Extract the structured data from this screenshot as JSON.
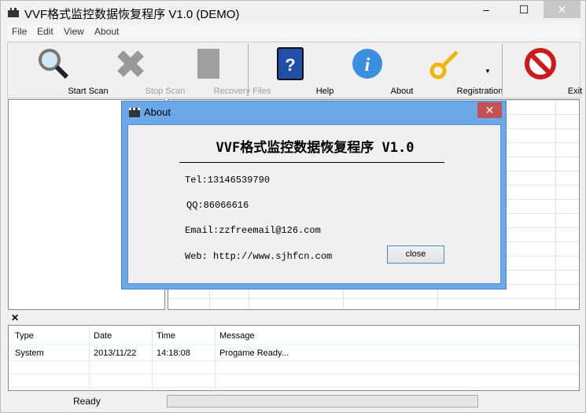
{
  "window": {
    "title": "VVF格式监控数据恢复程序 V1.0 (DEMO)",
    "minimize": "‒",
    "maximize": "☐",
    "close": "✕"
  },
  "menu": [
    "File",
    "Edit",
    "View",
    "About"
  ],
  "toolbar": [
    {
      "label": "Start Scan",
      "icon": "magnifier-icon",
      "enabled": true
    },
    {
      "label": "Stop Scan",
      "icon": "x-icon",
      "enabled": false
    },
    {
      "label": "Recovery  Files",
      "icon": "files-icon",
      "enabled": false
    },
    {
      "label": "Help",
      "icon": "help-book-icon",
      "enabled": true
    },
    {
      "label": "About",
      "icon": "info-icon",
      "enabled": true
    },
    {
      "label": "Registration",
      "icon": "key-icon",
      "enabled": true
    },
    {
      "label": "Exit",
      "icon": "no-entry-icon",
      "enabled": true
    }
  ],
  "log": {
    "close": "✕",
    "headers": [
      "Type",
      "Date",
      "Time",
      "Message"
    ],
    "rows": [
      [
        "System",
        "2013/11/22",
        "14:18:08",
        "Progame Ready..."
      ]
    ]
  },
  "status": {
    "text": "Ready"
  },
  "about_dialog": {
    "title": "About",
    "heading": "VVF格式监控数据恢复程序 V1.0",
    "tel": "Tel:13146539790",
    "qq": "QQ:86066616",
    "email": "Email:zzfreemail@126.com",
    "web": "Web: http://www.sjhfcn.com",
    "close_button": "close"
  }
}
